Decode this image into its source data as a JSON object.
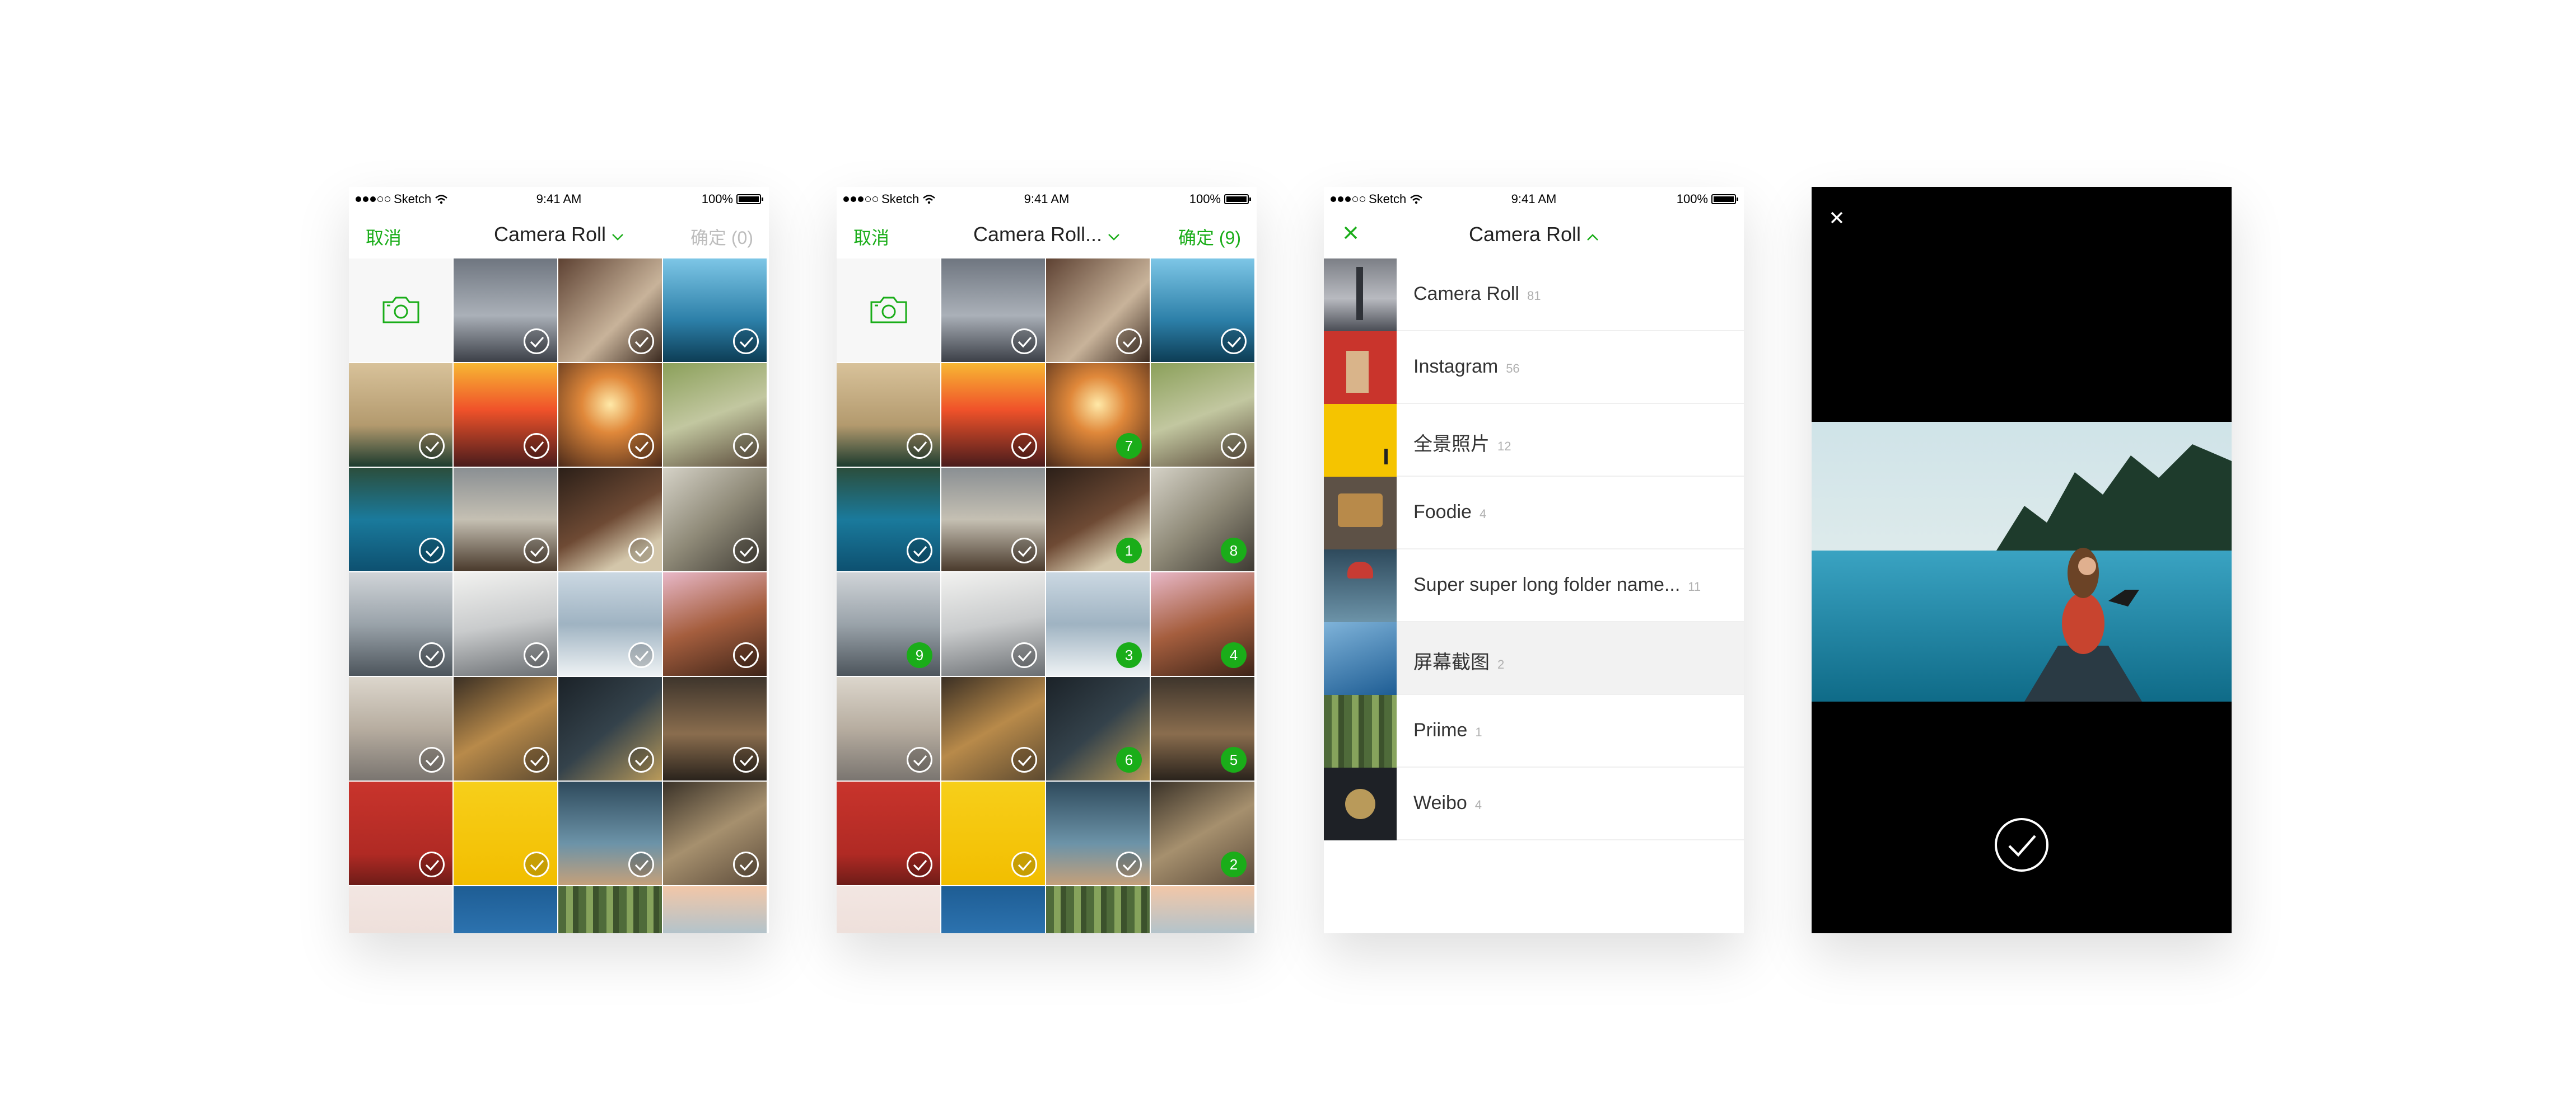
{
  "status_bar": {
    "carrier": "Sketch",
    "time": "9:41 AM",
    "battery": "100%"
  },
  "screen_grid_empty": {
    "cancel_label": "取消",
    "title": "Camera Roll",
    "confirm_label": "确定 (0)"
  },
  "screen_grid_selected": {
    "cancel_label": "取消",
    "title": "Camera Roll...",
    "confirm_label": "确定 (9)",
    "selection_numbers": [
      "7",
      "1",
      "8",
      "9",
      "3",
      "4",
      "6",
      "5",
      "2"
    ]
  },
  "screen_albums": {
    "title": "Camera Roll",
    "albums": [
      {
        "name": "Camera Roll",
        "count": "81"
      },
      {
        "name": "Instagram",
        "count": "56"
      },
      {
        "name": "全景照片",
        "count": "12"
      },
      {
        "name": "Foodie",
        "count": "4"
      },
      {
        "name": "Super super long folder name...",
        "count": "11"
      },
      {
        "name": "屏幕截图",
        "count": "2"
      },
      {
        "name": "Priime",
        "count": "1"
      },
      {
        "name": "Weibo",
        "count": "4"
      }
    ]
  },
  "colors": {
    "accent_green": "#1aad19",
    "disabled_gray": "#bdbdbd",
    "preview_background": "#000000"
  },
  "icons": [
    "camera-icon",
    "check-circle-icon",
    "chevron-down-icon",
    "chevron-up-icon",
    "close-icon",
    "wifi-icon",
    "battery-icon",
    "signal-dots-icon"
  ]
}
